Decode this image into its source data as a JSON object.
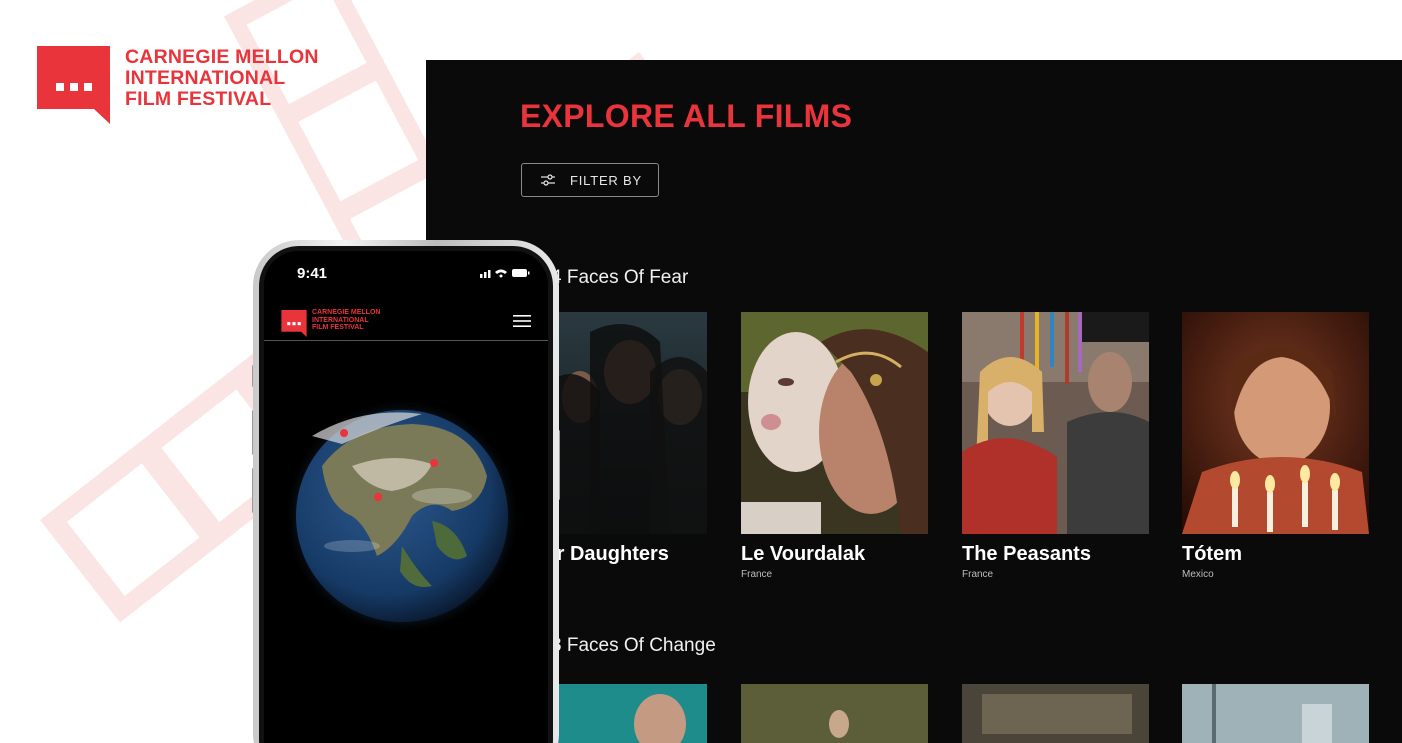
{
  "brand": {
    "lines": [
      "CARNEGIE MELLON",
      "INTERNATIONAL",
      "FILM FESTIVAL"
    ],
    "accent_color": "#e8343a"
  },
  "desktop": {
    "page_title": "EXPLORE ALL FILMS",
    "filter_label": "FILTER BY",
    "filter_icon": "sliders-icon",
    "sections": [
      {
        "title": "4 Faces Of Fear",
        "films": [
          {
            "title": "Four Daughters",
            "country": ""
          },
          {
            "title": "Le Vourdalak",
            "country": "France"
          },
          {
            "title": "The Peasants",
            "country": "France"
          },
          {
            "title": "Tótem",
            "country": "Mexico"
          }
        ]
      },
      {
        "title": "3 Faces Of Change",
        "films": []
      }
    ]
  },
  "phone": {
    "time": "9:41",
    "brand_lines": [
      "CARNEGIE MELLON",
      "INTERNATIONAL",
      "FILM FESTIVAL"
    ],
    "menu_icon": "hamburger-menu-icon",
    "globe_icon": "globe-map"
  }
}
